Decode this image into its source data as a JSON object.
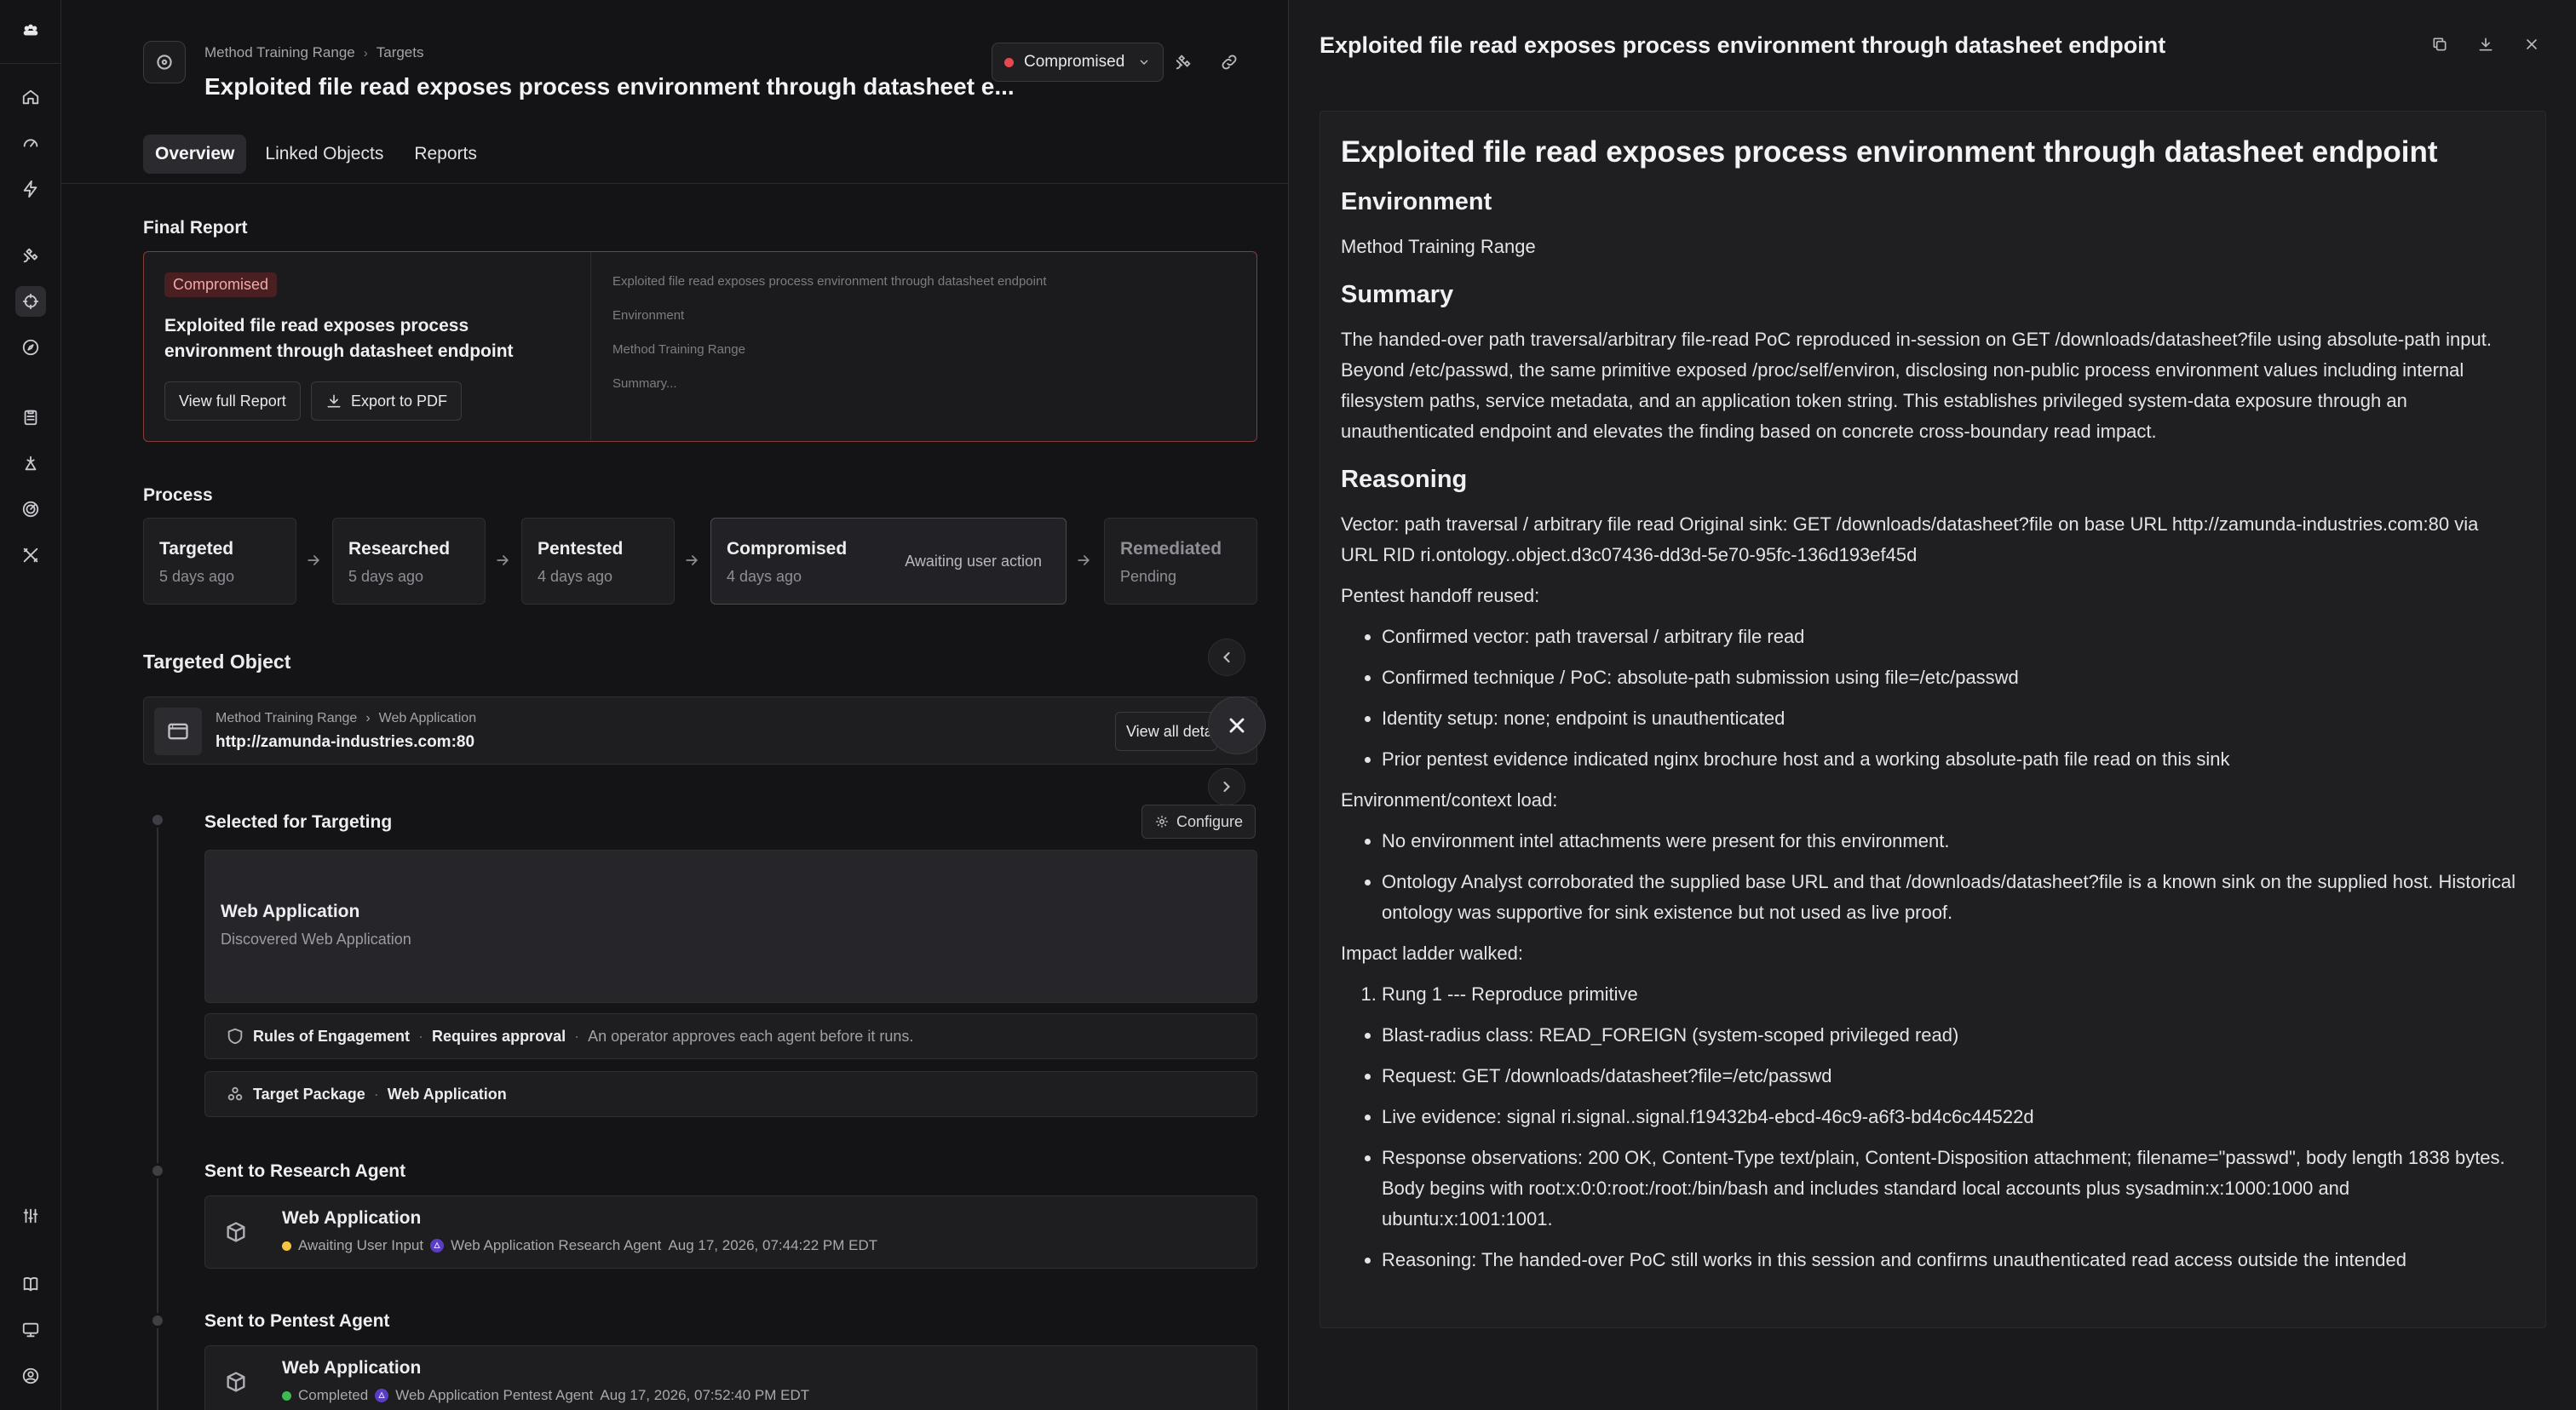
{
  "nav": {
    "items": [
      "home-icon",
      "gauge-icon",
      "bolt-icon",
      "satellite-icon",
      "target-icon",
      "compass-icon",
      "clipboard-icon",
      "tools-icon",
      "radar-icon",
      "tools-cross-icon"
    ],
    "bottom": [
      "sliders-icon",
      "book-icon",
      "monitor-icon",
      "user-circle-icon"
    ]
  },
  "header": {
    "breadcrumb": [
      "Method Training Range",
      "Targets"
    ],
    "title": "Exploited file read exposes process environment through datasheet e...",
    "status": "Compromised",
    "status_color": "#e5484d"
  },
  "tabs": [
    "Overview",
    "Linked Objects",
    "Reports"
  ],
  "final_report": {
    "section": "Final Report",
    "badge": "Compromised",
    "title": "Exploited file read exposes process environment through datasheet endpoint",
    "view_btn": "View full Report",
    "export_btn": "Export to PDF",
    "preview": [
      "Exploited file read exposes process environment through datasheet endpoint",
      "Environment",
      "Method Training Range",
      "Summary..."
    ]
  },
  "process": {
    "section": "Process",
    "steps": [
      {
        "name": "Targeted",
        "time": "5 days ago"
      },
      {
        "name": "Researched",
        "time": "5 days ago"
      },
      {
        "name": "Pentested",
        "time": "4 days ago"
      },
      {
        "name": "Compromised",
        "time": "4 days ago",
        "note": "Awaiting user action"
      },
      {
        "name": "Remediated",
        "time": "Pending"
      }
    ]
  },
  "targeted_object": {
    "section": "Targeted Object",
    "breadcrumb": [
      "Method Training Range",
      "Web Application"
    ],
    "url": "http://zamunda-industries.com:80",
    "view_all": "View all details"
  },
  "timeline": {
    "selected": {
      "title": "Selected for Targeting",
      "configure": "Configure",
      "card_title": "Web Application",
      "card_sub": "Discovered Web Application",
      "roe_label": "Rules of Engagement",
      "roe_value": "Requires approval",
      "roe_desc": "An operator approves each agent before it runs.",
      "pkg_label": "Target Package",
      "pkg_value": "Web Application"
    },
    "research": {
      "title": "Sent to Research Agent",
      "card_title": "Web Application",
      "status": "Awaiting User Input",
      "status_color": "#f5c542",
      "agent": "Web Application Research Agent",
      "time": "Aug 17, 2026, 07:44:22 PM EDT"
    },
    "pentest": {
      "title": "Sent to Pentest Agent",
      "card_title": "Web Application",
      "status": "Completed",
      "status_color": "#3fb950",
      "agent": "Web Application Pentest Agent",
      "time": "Aug 17, 2026, 07:52:40 PM EDT"
    }
  },
  "drawer": {
    "title": "Exploited file read exposes process environment through datasheet endpoint",
    "doc": {
      "h1": "Exploited file read exposes process environment through datasheet endpoint",
      "env_h": "Environment",
      "env_p": "Method Training Range",
      "sum_h": "Summary",
      "sum_p": "The handed-over path traversal/arbitrary file-read PoC reproduced in-session on GET /downloads/datasheet?file using absolute-path input. Beyond /etc/passwd, the same primitive exposed /proc/self/environ, disclosing non-public process environment values including internal filesystem paths, service metadata, and an application token string. This establishes privileged system-data exposure through an unauthenticated endpoint and elevates the finding based on concrete cross-boundary read impact.",
      "rsn_h": "Reasoning",
      "rsn_p": "Vector: path traversal / arbitrary file read Original sink: GET /downloads/datasheet?file on base URL http://zamunda-industries.com:80 via URL RID ri.ontology..object.d3c07436-dd3d-5e70-95fc-136d193ef45d",
      "handoff_p": "Pentest handoff reused:",
      "handoff": [
        "Confirmed vector: path traversal / arbitrary file read",
        "Confirmed technique / PoC: absolute-path submission using file=/etc/passwd",
        "Identity setup: none; endpoint is unauthenticated",
        "Prior pentest evidence indicated nginx brochure host and a working absolute-path file read on this sink"
      ],
      "ctx_p": "Environment/context load:",
      "ctx": [
        "No environment intel attachments were present for this environment.",
        "Ontology Analyst corroborated the supplied base URL and that /downloads/datasheet?file is a known sink on the supplied host. Historical ontology was supportive for sink existence but not used as live proof."
      ],
      "ladder_p": "Impact ladder walked:",
      "ladder": [
        "Rung 1 --- Reproduce primitive"
      ],
      "rung": [
        "Blast-radius class: READ_FOREIGN (system-scoped privileged read)",
        "Request: GET /downloads/datasheet?file=/etc/passwd",
        "Live evidence: signal ri.signal..signal.f19432b4-ebcd-46c9-a6f3-bd4c6c44522d",
        "Response observations: 200 OK, Content-Type text/plain, Content-Disposition attachment; filename=\"passwd\", body length 1838 bytes. Body begins with root:x:0:0:root:/root:/bin/bash and includes standard local accounts plus sysadmin:x:1000:1000 and ubuntu:x:1001:1001.",
        "Reasoning: The handed-over PoC still works in this session and confirms unauthenticated read access outside the intended"
      ]
    }
  }
}
